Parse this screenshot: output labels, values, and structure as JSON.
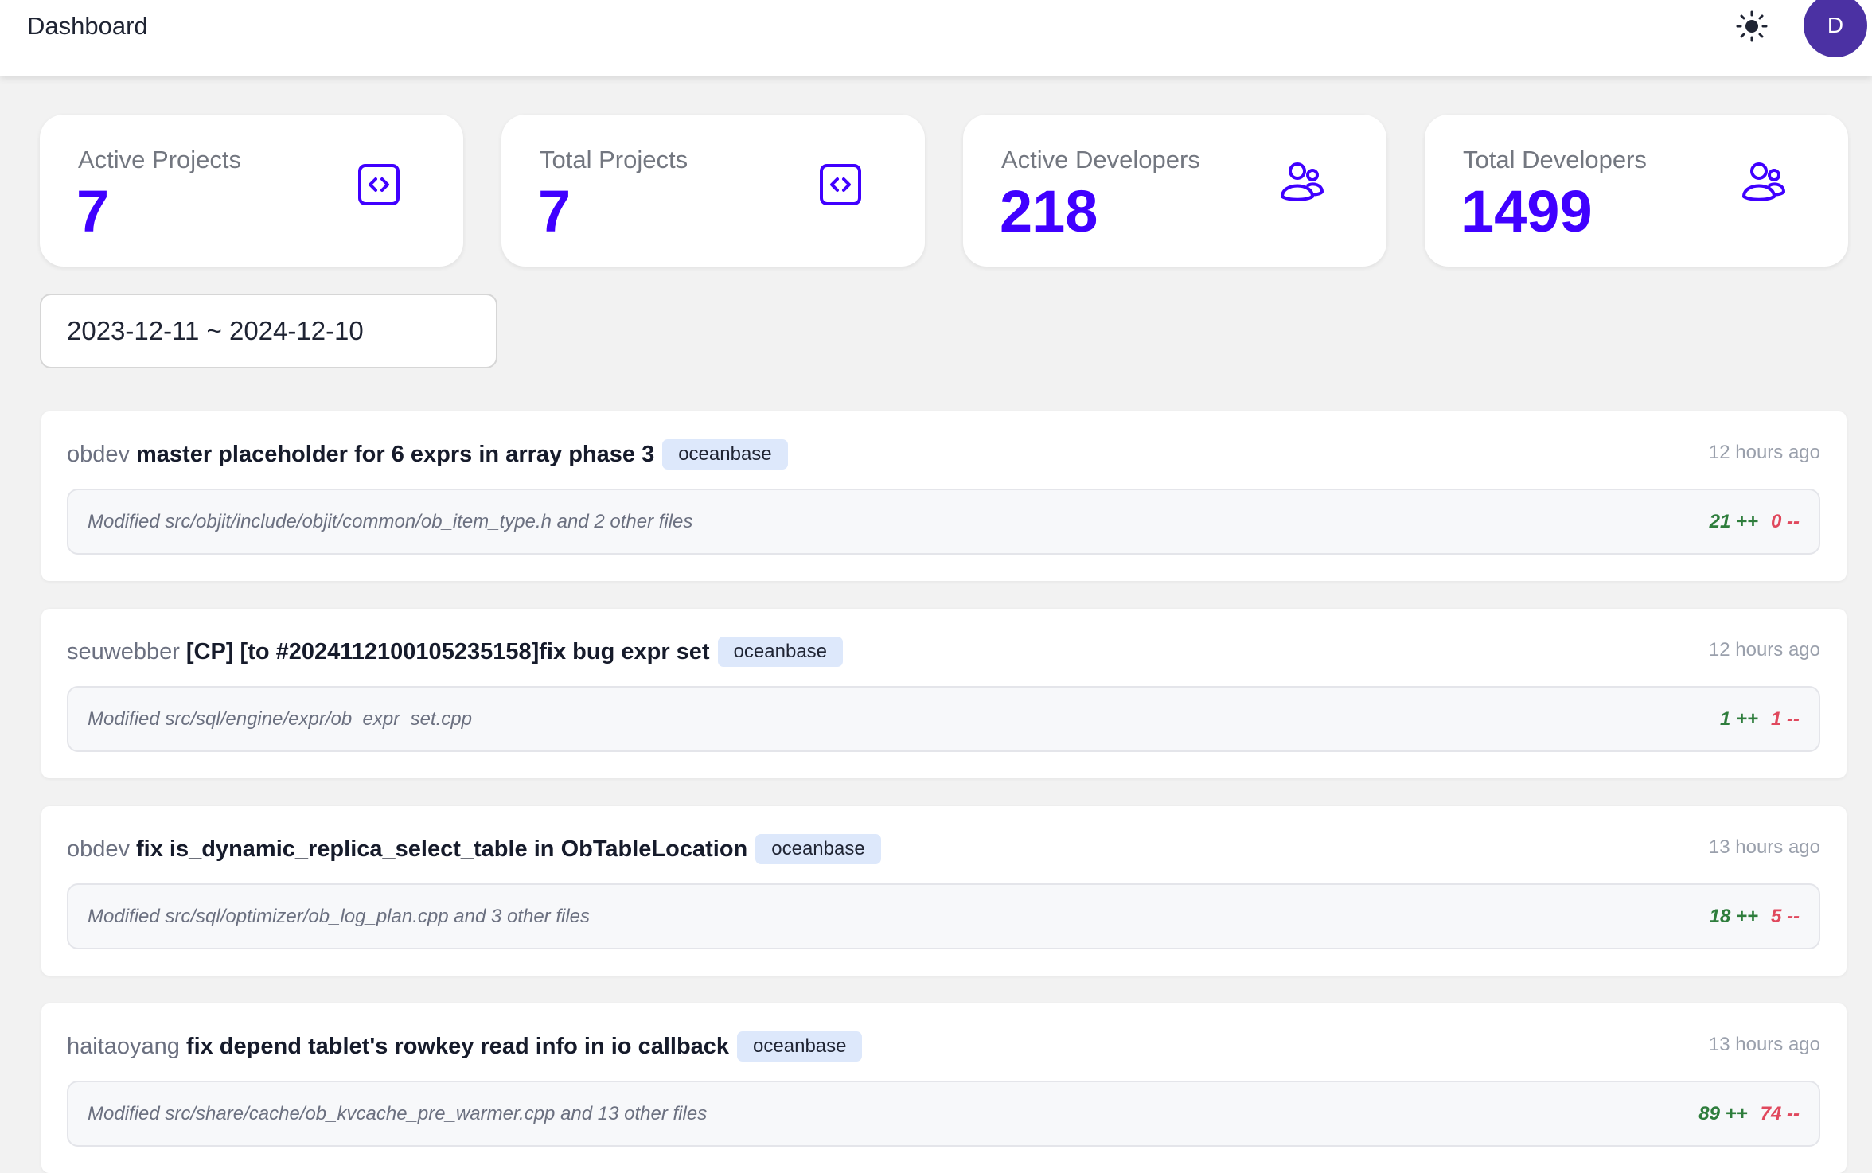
{
  "header": {
    "title": "Dashboard",
    "theme_icon": "sun-icon",
    "avatar_initial": "D"
  },
  "colors": {
    "accent": "#4000ff",
    "avatar": "#4b31a3",
    "additions": "#2e7d3c",
    "deletions": "#e0485d",
    "badge_bg": "#dde8fb"
  },
  "stats": [
    {
      "label": "Active Projects",
      "value": "7",
      "icon": "code-icon"
    },
    {
      "label": "Total Projects",
      "value": "7",
      "icon": "code-icon"
    },
    {
      "label": "Active Developers",
      "value": "218",
      "icon": "users-icon"
    },
    {
      "label": "Total Developers",
      "value": "1499",
      "icon": "users-icon"
    }
  ],
  "date_range": {
    "value": "2023-12-11 ~ 2024-12-10"
  },
  "commits": [
    {
      "author": "obdev",
      "message": "master placeholder for 6 exprs in array phase 3",
      "repo": "oceanbase",
      "time": "12 hours ago",
      "files": "Modified src/objit/include/objit/common/ob_item_type.h and 2 other files",
      "additions": "21 ++",
      "deletions": "0 --"
    },
    {
      "author": "seuwebber",
      "message": "[CP] [to #2024112100105235158]fix bug expr set",
      "repo": "oceanbase",
      "time": "12 hours ago",
      "files": "Modified src/sql/engine/expr/ob_expr_set.cpp",
      "additions": "1 ++",
      "deletions": "1 --"
    },
    {
      "author": "obdev",
      "message": "fix is_dynamic_replica_select_table in ObTableLocation",
      "repo": "oceanbase",
      "time": "13 hours ago",
      "files": "Modified src/sql/optimizer/ob_log_plan.cpp and 3 other files",
      "additions": "18 ++",
      "deletions": "5 --"
    },
    {
      "author": "haitaoyang",
      "message": "fix depend tablet's rowkey read info in io callback",
      "repo": "oceanbase",
      "time": "13 hours ago",
      "files": "Modified src/share/cache/ob_kvcache_pre_warmer.cpp and 13 other files",
      "additions": "89 ++",
      "deletions": "74 --"
    }
  ]
}
